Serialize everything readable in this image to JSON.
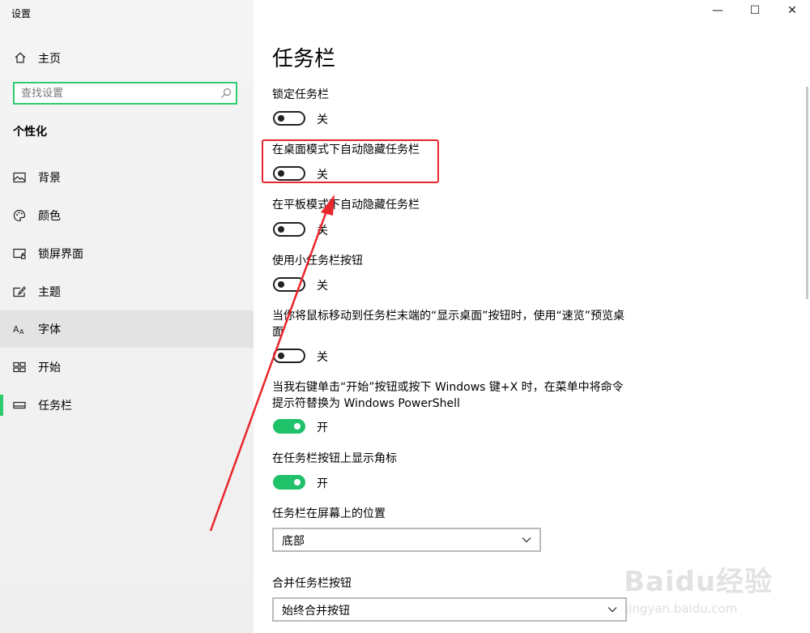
{
  "window": {
    "title": "设置",
    "controls": {
      "minimize": "—",
      "maximize": "☐",
      "close": "✕"
    }
  },
  "sidebar": {
    "home_label": "主页",
    "search_placeholder": "查找设置",
    "section": "个性化",
    "items": [
      {
        "label": "背景",
        "icon": "picture-icon"
      },
      {
        "label": "颜色",
        "icon": "palette-icon"
      },
      {
        "label": "锁屏界面",
        "icon": "lockscreen-icon"
      },
      {
        "label": "主题",
        "icon": "theme-brush-icon"
      },
      {
        "label": "字体",
        "icon": "font-icon"
      },
      {
        "label": "开始",
        "icon": "start-tiles-icon"
      },
      {
        "label": "任务栏",
        "icon": "taskbar-icon"
      }
    ],
    "selected": "任务栏",
    "hovered": "字体"
  },
  "main": {
    "title": "任务栏",
    "settings": [
      {
        "label": "锁定任务栏",
        "state": "关",
        "on": false
      },
      {
        "label": "在桌面模式下自动隐藏任务栏",
        "state": "关",
        "on": false
      },
      {
        "label": "在平板模式下自动隐藏任务栏",
        "state": "关",
        "on": false
      },
      {
        "label": "使用小任务栏按钮",
        "state": "关",
        "on": false
      },
      {
        "label": "当你将鼠标移动到任务栏末端的“显示桌面”按钮时，使用“速览”预览桌面",
        "state": "关",
        "on": false
      },
      {
        "label": "当我右键单击“开始”按钮或按下 Windows 键+X 时，在菜单中将命令提示符替换为 Windows PowerShell",
        "state": "开",
        "on": true
      },
      {
        "label": "在任务栏按钮上显示角标",
        "state": "开",
        "on": true
      }
    ],
    "dropdowns": [
      {
        "label": "任务栏在屏幕上的位置",
        "value": "底部"
      },
      {
        "label": "合并任务栏按钮",
        "value": "始终合并按钮"
      }
    ]
  },
  "annotation": {
    "highlight_color": "#e8262b",
    "arrow_color": "#e8262b"
  },
  "watermark": {
    "brand": "Baidu经验",
    "url": "jingyan.baidu.com"
  },
  "colors": {
    "accent": "#2ecc71",
    "toggle_on": "#1fc169"
  }
}
